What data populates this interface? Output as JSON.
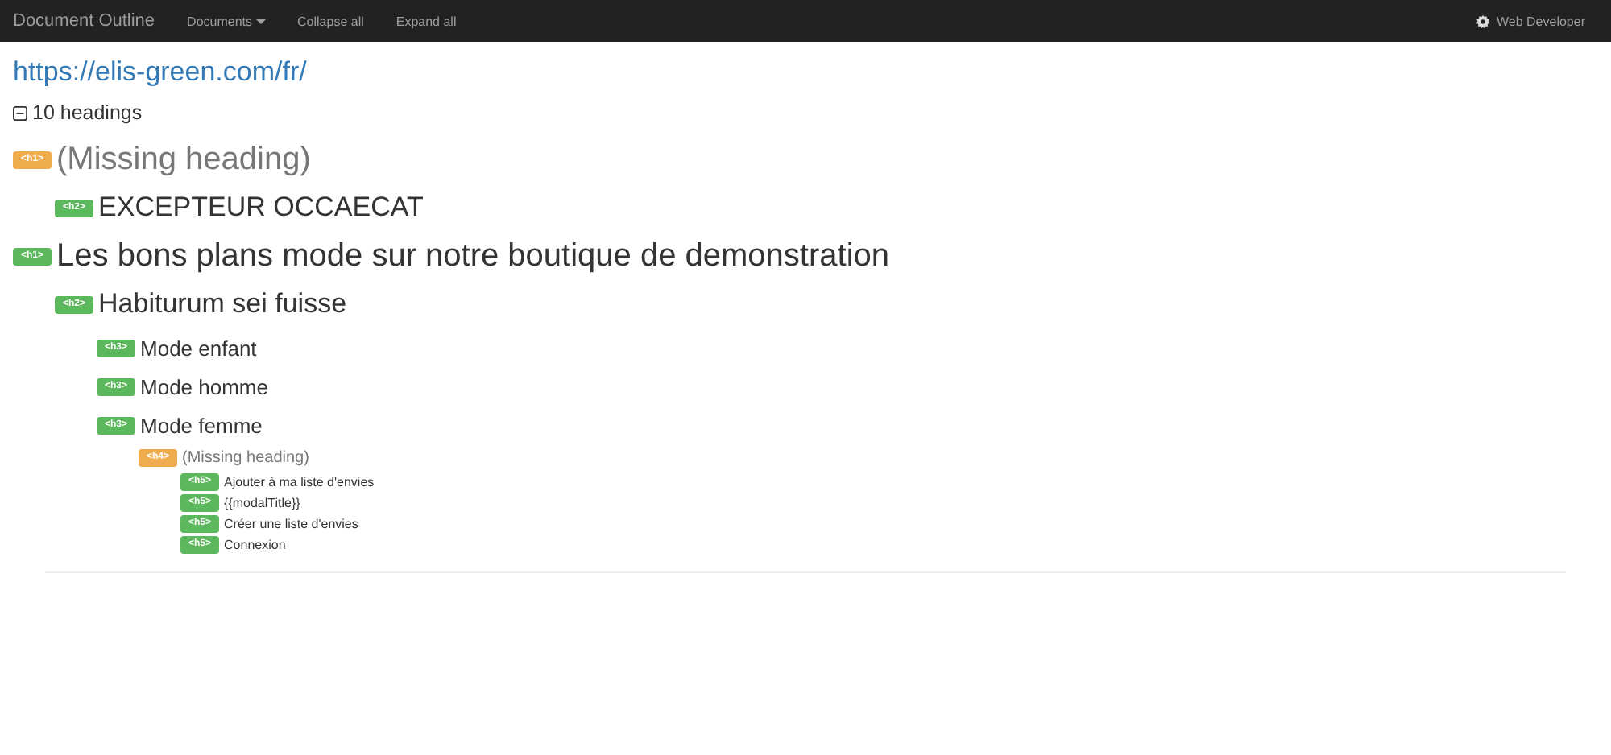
{
  "navbar": {
    "brand": "Document Outline",
    "menu": [
      {
        "label": "Documents",
        "dropdown": true
      },
      {
        "label": "Collapse all",
        "dropdown": false
      },
      {
        "label": "Expand all",
        "dropdown": false
      }
    ],
    "right": "Web Developer"
  },
  "url": "https://elis-green.com/fr/",
  "summary": {
    "label": "10 headings",
    "expanded": true
  },
  "outline": [
    {
      "tag": "<h1>",
      "text": "(Missing heading)",
      "missing": true,
      "children": [
        {
          "tag": "<h2>",
          "text": "EXCEPTEUR OCCAECAT",
          "missing": false
        }
      ]
    },
    {
      "tag": "<h1>",
      "text": "Les bons plans mode sur notre boutique de demonstration",
      "missing": false,
      "children": [
        {
          "tag": "<h2>",
          "text": "Habiturum sei fuisse",
          "missing": false,
          "children": [
            {
              "tag": "<h3>",
              "text": "Mode enfant",
              "missing": false
            },
            {
              "tag": "<h3>",
              "text": "Mode homme",
              "missing": false
            },
            {
              "tag": "<h3>",
              "text": "Mode femme",
              "missing": false,
              "children": [
                {
                  "tag": "<h4>",
                  "text": "(Missing heading)",
                  "missing": true,
                  "children": [
                    {
                      "tag": "<h5>",
                      "text": "Ajouter à ma liste d'envies",
                      "missing": false
                    },
                    {
                      "tag": "<h5>",
                      "text": "{{modalTitle}}",
                      "missing": false
                    },
                    {
                      "tag": "<h5>",
                      "text": "Créer une liste d'envies",
                      "missing": false
                    },
                    {
                      "tag": "<h5>",
                      "text": "Connexion",
                      "missing": false
                    }
                  ]
                }
              ]
            }
          ]
        }
      ]
    }
  ]
}
